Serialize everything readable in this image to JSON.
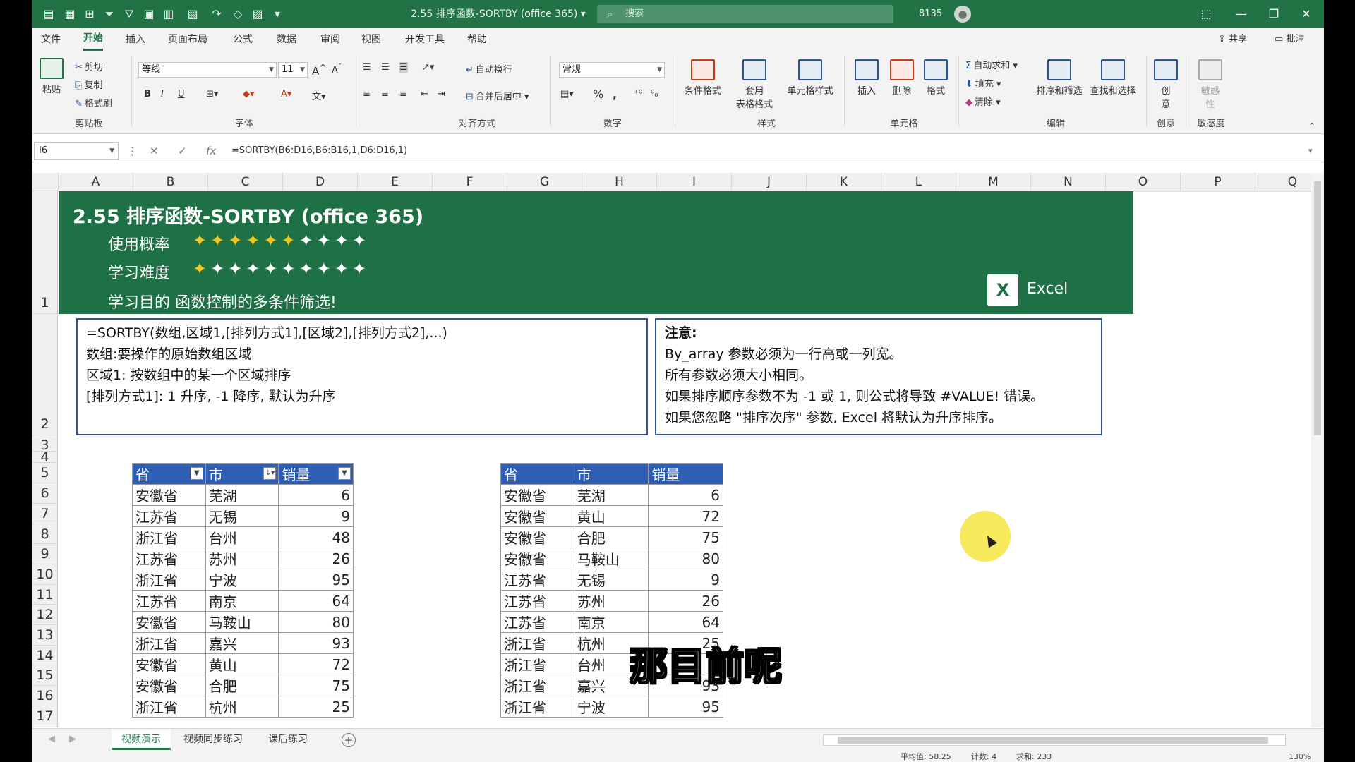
{
  "titlebar": {
    "doc_title": "2.55 排序函数-SORTBY (office 365) ▾",
    "search_placeholder": "搜索",
    "user_id": "8135",
    "minimize": "—",
    "restore": "❐",
    "close": "✕"
  },
  "menu": {
    "tabs": [
      "文件",
      "开始",
      "插入",
      "页面布局",
      "公式",
      "数据",
      "审阅",
      "视图",
      "开发工具",
      "帮助"
    ],
    "active": "开始",
    "share": "共享",
    "comments": "批注"
  },
  "ribbon": {
    "clipboard": {
      "paste": "粘贴",
      "cut": "剪切",
      "copy": "复制",
      "format_painter": "格式刷",
      "label": "剪贴板"
    },
    "font": {
      "name": "等线",
      "size": "11",
      "bold": "B",
      "italic": "I",
      "underline": "U",
      "label": "字体"
    },
    "alignment": {
      "wrap": "自动换行",
      "merge": "合并后居中",
      "label": "对齐方式"
    },
    "number": {
      "format": "常规",
      "percent": "%",
      "label": "数字"
    },
    "styles": {
      "conditional": "条件格式",
      "table": "套用\n表格格式",
      "cell_styles": "单元格样式",
      "label": "样式"
    },
    "cells": {
      "insert": "插入",
      "delete": "删除",
      "format": "格式",
      "label": "单元格"
    },
    "editing": {
      "autosum": "自动求和",
      "fill": "填充",
      "clear": "清除",
      "sort_filter": "排序和筛选",
      "find_select": "查找和选择",
      "label": "编辑"
    },
    "ideas": {
      "label_btn": "创\n意",
      "label": "创意"
    },
    "sensitivity": {
      "label_btn": "敏感\n性",
      "label": "敏感度"
    }
  },
  "formula_bar": {
    "name_box": "I6",
    "formula": "=SORTBY(B6:D16,B6:B16,1,D6:D16,1)"
  },
  "columns": [
    "A",
    "B",
    "C",
    "D",
    "E",
    "F",
    "G",
    "H",
    "I",
    "J",
    "K",
    "L",
    "M",
    "N",
    "O",
    "P",
    "Q"
  ],
  "rows": [
    "1",
    "2",
    "3",
    "4",
    "5",
    "6",
    "7",
    "8",
    "9",
    "10",
    "11",
    "12",
    "13",
    "14",
    "15",
    "16",
    "17"
  ],
  "banner": {
    "title": "2.55 排序函数-SORTBY (office 365)",
    "usage_label": "使用概率",
    "usage_stars": 6,
    "difficulty_label": "学习难度",
    "difficulty_stars": 1,
    "stars_total": 10,
    "purpose": "学习目的  函数控制的多条件筛选!",
    "logo_text": "Excel",
    "colors": {
      "banner": "#1e7145",
      "star_on": "#f5c518",
      "star_off": "#ffffff"
    }
  },
  "syntax_box": {
    "lines": [
      "=SORTBY(数组,区域1,[排列方式1],[区域2],[排列方式2],...)",
      "数组:要操作的原始数组区域",
      "区域1:  按数组中的某一个区域排序",
      "[排列方式1]: 1 升序, -1 降序, 默认为升序"
    ]
  },
  "note_box": {
    "heading": "注意:",
    "lines": [
      "By_array 参数必须为一行高或一列宽。",
      "所有参数必须大小相同。",
      "如果排序顺序参数不为 -1 或 1, 则公式将导致 #VALUE! 错误。",
      "如果您忽略 \"排序次序\" 参数, Excel 将默认为升序排序。"
    ]
  },
  "source_table": {
    "headers": [
      "省",
      "市",
      "销量"
    ],
    "rows": [
      [
        "安徽省",
        "芜湖",
        "6"
      ],
      [
        "江苏省",
        "无锡",
        "9"
      ],
      [
        "浙江省",
        "台州",
        "48"
      ],
      [
        "江苏省",
        "苏州",
        "26"
      ],
      [
        "浙江省",
        "宁波",
        "95"
      ],
      [
        "江苏省",
        "南京",
        "64"
      ],
      [
        "安徽省",
        "马鞍山",
        "80"
      ],
      [
        "浙江省",
        "嘉兴",
        "93"
      ],
      [
        "安徽省",
        "黄山",
        "72"
      ],
      [
        "安徽省",
        "合肥",
        "75"
      ],
      [
        "浙江省",
        "杭州",
        "25"
      ]
    ]
  },
  "result_table": {
    "headers": [
      "省",
      "市",
      "销量"
    ],
    "rows": [
      [
        "安徽省",
        "芜湖",
        "6"
      ],
      [
        "安徽省",
        "黄山",
        "72"
      ],
      [
        "安徽省",
        "合肥",
        "75"
      ],
      [
        "安徽省",
        "马鞍山",
        "80"
      ],
      [
        "江苏省",
        "无锡",
        "9"
      ],
      [
        "江苏省",
        "苏州",
        "26"
      ],
      [
        "江苏省",
        "南京",
        "64"
      ],
      [
        "浙江省",
        "杭州",
        "25"
      ],
      [
        "浙江省",
        "台州",
        ""
      ],
      [
        "浙江省",
        "嘉兴",
        "93"
      ],
      [
        "浙江省",
        "宁波",
        "95"
      ]
    ]
  },
  "subtitle": "那目前呢",
  "sheets": {
    "tabs": [
      "视频演示",
      "视频同步练习",
      "课后练习"
    ],
    "active": "视频演示"
  },
  "status": {
    "average": "平均值: 58.25",
    "count": "计数: 4",
    "sum": "求和: 233",
    "zoom": "130%"
  }
}
